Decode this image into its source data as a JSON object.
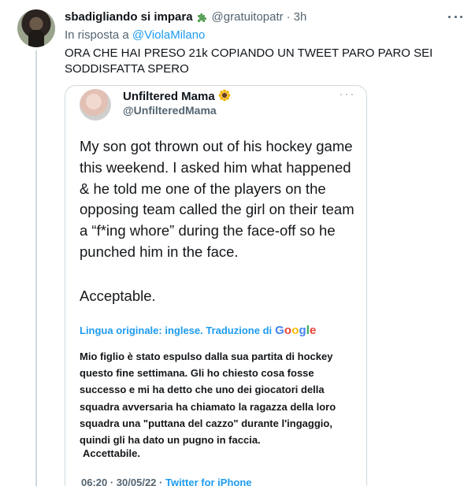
{
  "tweet": {
    "display_name": "sbadigliando si impara",
    "handle": "@gratuitopatr",
    "separator": "·",
    "time": "3h",
    "reply_prefix": "In risposta a",
    "reply_mention": "@ViolaMilano",
    "text": "ORA CHE HAI PRESO 21k COPIANDO UN TWEET PARO PARO SEI SODDISFATTA SPERO"
  },
  "quote": {
    "display_name": "Unfiltered Mama",
    "handle": "@UnfilteredMama",
    "body": "My son got thrown out of his hockey game this weekend. I asked him what happened & he told me one of the players on the opposing team called the girl on their team a “f*ing whore” during the face-off so he punched him in the face.",
    "acceptable": "Acceptable.",
    "translation_label": "Lingua originale: inglese. Traduzione di",
    "google_letters": [
      "G",
      "o",
      "o",
      "g",
      "l",
      "e"
    ],
    "translated_body": "Mio figlio è stato espulso dalla sua partita di hockey questo fine settimana. Gli ho chiesto cosa fosse successo e mi ha detto che uno dei giocatori della squadra avversaria ha chiamato la ragazza della loro squadra una \"puttana del cazzo\" durante l'ingaggio, quindi gli ha dato un pugno in faccia.",
    "translated_acceptable": "Accettabile.",
    "footer_time": "06:20 · 30/05/22 ·",
    "footer_source": "Twitter for iPhone"
  },
  "icons": {
    "badge": "puzzle-piece-icon",
    "quote_badge": "sunflower-icon",
    "more": "more-options-icon"
  },
  "colors": {
    "link": "#1d9bf0",
    "secondary_text": "#536471",
    "border": "#cfd9de"
  }
}
